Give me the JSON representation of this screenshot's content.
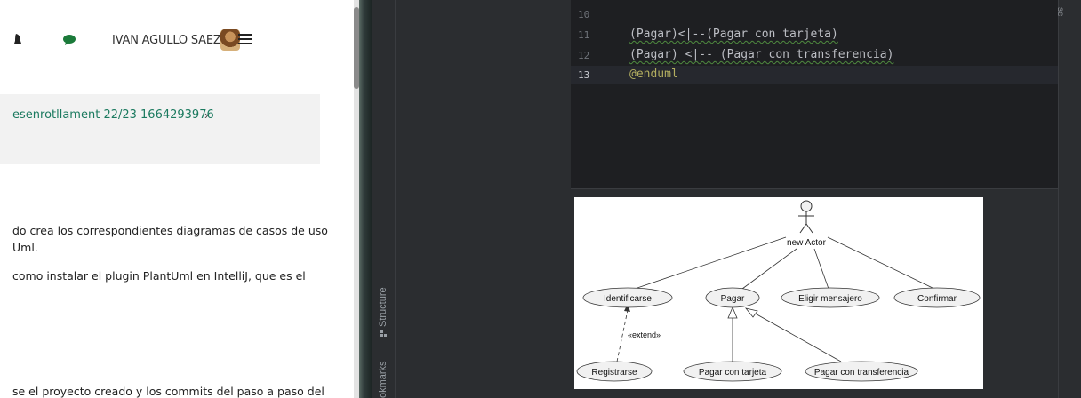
{
  "browser": {
    "user_name": "IVAN AGULLO SAEZ",
    "breadcrumb": "esenrotllament 22/23 1664293976",
    "breadcrumb_chevron": "›",
    "paragraphs": [
      "do crea los correspondientes diagramas de casos de uso",
      "Uml.",
      "como instalar el plugin PlantUml en IntelliJ, que es el",
      "se el proyecto creado y los commits del paso a paso del"
    ],
    "icons": [
      "bell-icon",
      "chat-icon",
      "avatar",
      "menu-icon"
    ],
    "accent_color": "#1b7a5f"
  },
  "ide": {
    "tool_windows": {
      "structure": "Structure",
      "bookmarks": "okmarks"
    },
    "right_label": "se",
    "lines": [
      {
        "num": "10",
        "code": ""
      },
      {
        "num": "11",
        "code": "(Pagar)<|--(Pagar con tarjeta)"
      },
      {
        "num": "12",
        "code": "(Pagar) <|-- (Pagar con transferencia)"
      },
      {
        "num": "13",
        "code": "@enduml"
      }
    ],
    "colors": {
      "background": "#1e1f22",
      "keyword": "#b3ae60",
      "text": "#bcbec4"
    }
  },
  "diagram": {
    "actor": "new Actor",
    "use_cases": {
      "identificarse": "Identificarse",
      "pagar": "Pagar",
      "elegir": "Eligir mensajero",
      "confirmar": "Confirmar",
      "registrarse": "Registrarse",
      "pagar_tarjeta": "Pagar con tarjeta",
      "pagar_transferencia": "Pagar con transferencia"
    },
    "extend_label": "«extend»"
  }
}
